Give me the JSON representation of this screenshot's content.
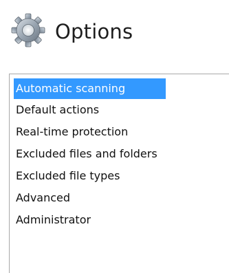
{
  "header": {
    "title": "Options",
    "icon": "gear-icon"
  },
  "options_list": {
    "selected_index": 0,
    "selection_color": "#3399ff",
    "items": [
      {
        "label": "Automatic scanning"
      },
      {
        "label": "Default actions"
      },
      {
        "label": "Real-time protection"
      },
      {
        "label": "Excluded files and folders"
      },
      {
        "label": "Excluded file types"
      },
      {
        "label": "Advanced"
      },
      {
        "label": "Administrator"
      }
    ]
  }
}
